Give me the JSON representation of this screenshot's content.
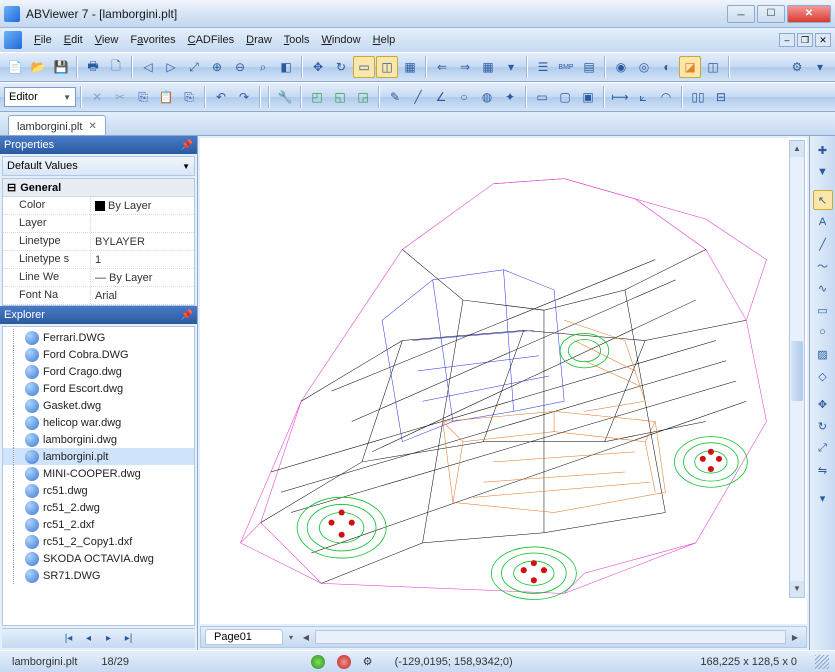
{
  "window": {
    "title": "ABViewer 7 - [lamborgini.plt]"
  },
  "menus": [
    "File",
    "Edit",
    "View",
    "Favorites",
    "CADFiles",
    "Draw",
    "Tools",
    "Window",
    "Help"
  ],
  "editor_combo": "Editor",
  "doc_tab": "lamborgini.plt",
  "properties": {
    "title": "Properties",
    "preset": "Default Values",
    "group": "General",
    "rows": [
      {
        "k": "Color",
        "v": "By Layer",
        "swatch": true
      },
      {
        "k": "Layer",
        "v": ""
      },
      {
        "k": "Linetype",
        "v": "BYLAYER"
      },
      {
        "k": "Linetype s",
        "v": "1"
      },
      {
        "k": "Line We",
        "v": "— By Layer"
      },
      {
        "k": "Font Na",
        "v": "Arial"
      }
    ]
  },
  "explorer": {
    "title": "Explorer",
    "items": [
      "Ferrari.DWG",
      "Ford Cobra.DWG",
      "Ford Crago.dwg",
      "Ford Escort.dwg",
      "Gasket.dwg",
      "helicop war.dwg",
      "lamborgini.dwg",
      "lamborgini.plt",
      "MINI-COOPER.dwg",
      "rc51.dwg",
      "rc51_2.dwg",
      "rc51_2.dxf",
      "rc51_2_Copy1.dxf",
      "SKODA OCTAVIA.dwg",
      "SR71.DWG"
    ],
    "selected": "lamborgini.plt"
  },
  "page": "Page01",
  "status": {
    "file": "lamborgini.plt",
    "count": "18/29",
    "coords": "(-129,0195; 158,9342;0)",
    "size": "168,225 x 128,5 x 0"
  }
}
